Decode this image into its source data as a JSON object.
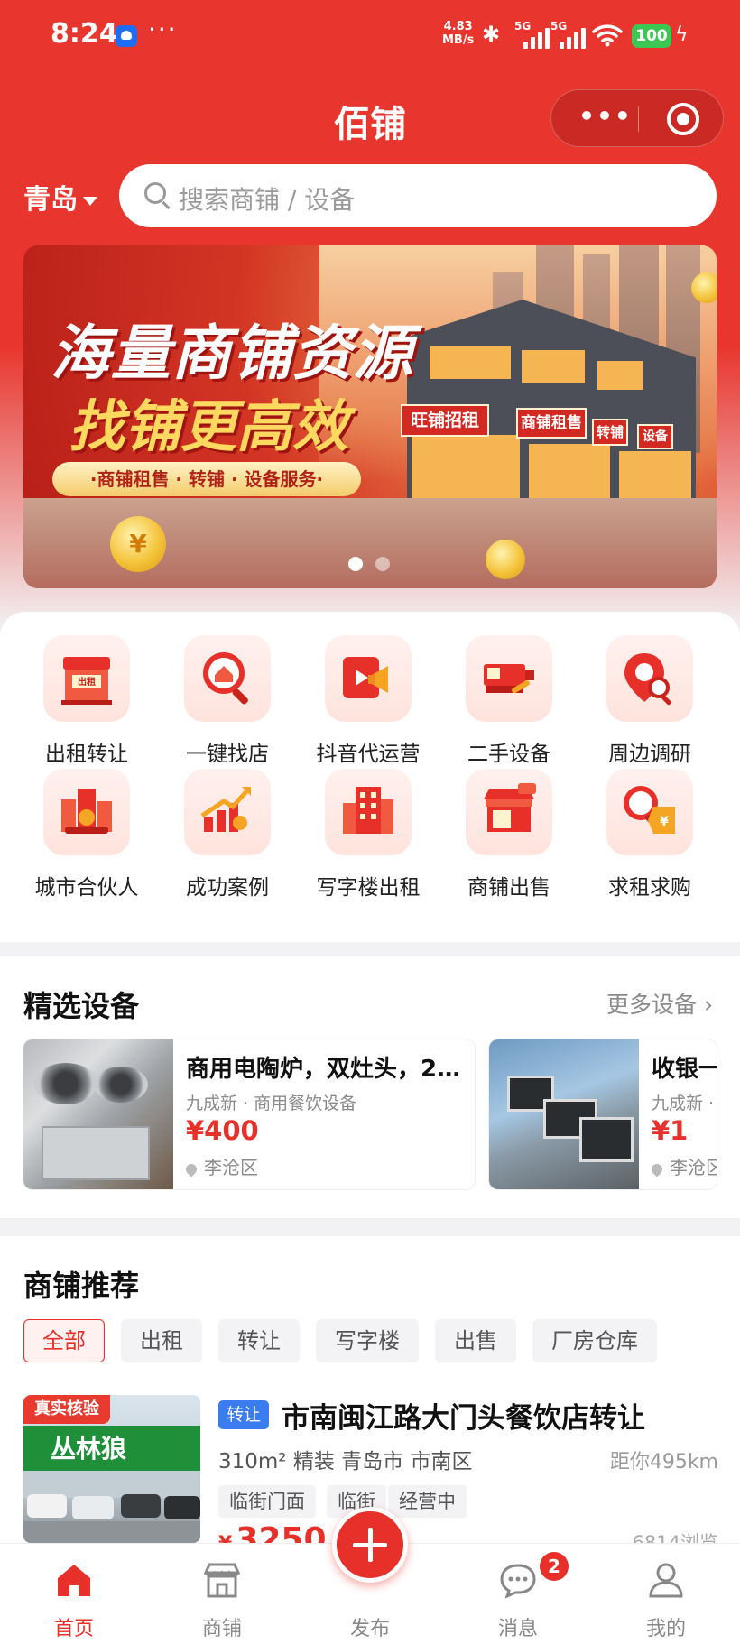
{
  "status_bar": {
    "time": "8:24",
    "dots": "···",
    "speed_top": "4.83",
    "speed_bottom": "MB/s",
    "sim1": "5G",
    "sim2": "5G",
    "battery": "100"
  },
  "header": {
    "title": "佰铺",
    "capsule_more_icon": "more-dots-icon",
    "capsule_close_icon": "target-circle-icon"
  },
  "location": {
    "city": "青岛"
  },
  "search": {
    "placeholder": "搜索商铺 / 设备"
  },
  "banner": {
    "headline_1": "海量商铺资源",
    "headline_2": "找铺更高效",
    "tagline": "·商铺租售 · 转铺 · 设备服务·",
    "sign_1": "旺铺招租",
    "sign_2": "商铺租售",
    "sign_3": "转铺",
    "sign_4": "设备",
    "coin_symbol": "¥",
    "active_slide": 1,
    "slide_count": 2
  },
  "categories": [
    {
      "label": "出租转让",
      "icon": "storefront-rent-icon"
    },
    {
      "label": "一键找店",
      "icon": "magnifier-shop-icon"
    },
    {
      "label": "抖音代运营",
      "icon": "video-megaphone-icon"
    },
    {
      "label": "二手设备",
      "icon": "machine-tool-icon"
    },
    {
      "label": "周边调研",
      "icon": "location-search-icon"
    },
    {
      "label": "城市合伙人",
      "icon": "city-partners-icon"
    },
    {
      "label": "成功案例",
      "icon": "growth-chart-icon"
    },
    {
      "label": "写字楼出租",
      "icon": "office-building-icon"
    },
    {
      "label": "商铺出售",
      "icon": "shop-sale-icon"
    },
    {
      "label": "求租求购",
      "icon": "search-price-tag-icon"
    }
  ],
  "equipment": {
    "title": "精选设备",
    "more": "更多设备",
    "items": [
      {
        "title": "商用电陶炉，双灶头，2…",
        "sub": "九成新 · 商用餐饮设备",
        "price": "¥400",
        "location": "李沧区"
      },
      {
        "title": "收银一",
        "sub": "九成新 ·",
        "price": "¥1",
        "location": "李沧区"
      }
    ]
  },
  "shops": {
    "title": "商铺推荐",
    "tabs": [
      "全部",
      "出租",
      "转让",
      "写字楼",
      "出售",
      "厂房仓库"
    ],
    "active_tab": 0,
    "items": [
      {
        "verified": "真实核验",
        "type": "转让",
        "name": "市南闽江路大门头餐饮店转让",
        "meta": "310m² 精装 青岛市 市南区",
        "distance": "距你495km",
        "features": [
          "临街门面",
          "临街",
          "经营中"
        ],
        "price_prefix": "¥",
        "price": "3250",
        "views": "6814浏览",
        "photo_sign": "丛林狼"
      }
    ]
  },
  "tabbar": {
    "items": [
      {
        "label": "首页",
        "icon": "home-icon"
      },
      {
        "label": "商铺",
        "icon": "shop-icon"
      },
      {
        "label": "发布",
        "icon": "plus-icon"
      },
      {
        "label": "消息",
        "icon": "chat-bubble-icon"
      },
      {
        "label": "我的",
        "icon": "user-icon"
      }
    ],
    "active": 0,
    "message_badge": "2"
  },
  "colors": {
    "brand": "#e8302a",
    "tab_blue": "#3b7df0",
    "battery_green": "#3cc752"
  }
}
